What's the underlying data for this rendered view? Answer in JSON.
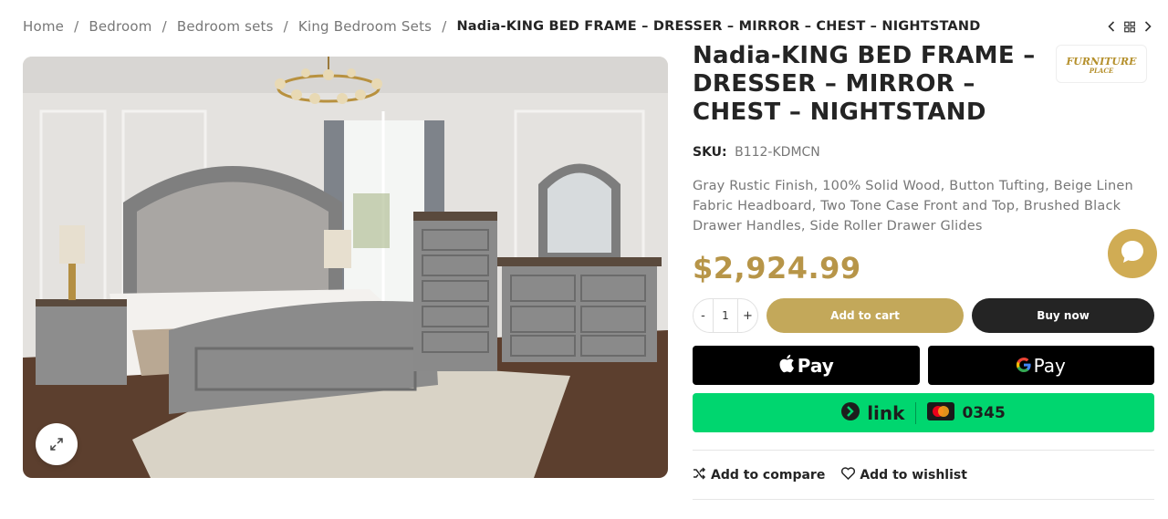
{
  "breadcrumb": {
    "items": [
      "Home",
      "Bedroom",
      "Bedroom sets",
      "King Bedroom Sets"
    ],
    "separator": "/",
    "current": "Nadia-KING BED FRAME – DRESSER – MIRROR – CHEST – NIGHTSTAND"
  },
  "product": {
    "title": "Nadia-KING BED FRAME – DRESSER – MIRROR – CHEST – NIGHTSTAND",
    "brand_logo_text": "FURNITURE PLACE",
    "sku_label": "SKU:",
    "sku_value": "B112-KDMCN",
    "description": "Gray Rustic Finish, 100% Solid Wood, Button Tufting, Beige Linen Fabric Headboard, Two Tone Case Front and Top, Brushed Black Drawer Handles, Side Roller Drawer Glides",
    "price": "$2,924.99"
  },
  "cart": {
    "minus": "-",
    "quantity": "1",
    "plus": "+",
    "add_to_cart": "Add to cart",
    "buy_now": "Buy now"
  },
  "wallets": {
    "apple_pay": "Pay",
    "google_pay": "Pay",
    "link_text": "link",
    "card_last4": "0345"
  },
  "actions": {
    "compare": "Add to compare",
    "wishlist": "Add to wishlist"
  },
  "colors": {
    "accent": "#c3a85a",
    "price": "#b79548",
    "dark": "#242424",
    "link_green": "#00d66f"
  },
  "icons": [
    "chevron-left-icon",
    "grid-icon",
    "chevron-right-icon",
    "expand-icon",
    "apple-icon",
    "google-g-icon",
    "mastercard-icon",
    "shuffle-icon",
    "heart-icon",
    "chat-icon"
  ]
}
